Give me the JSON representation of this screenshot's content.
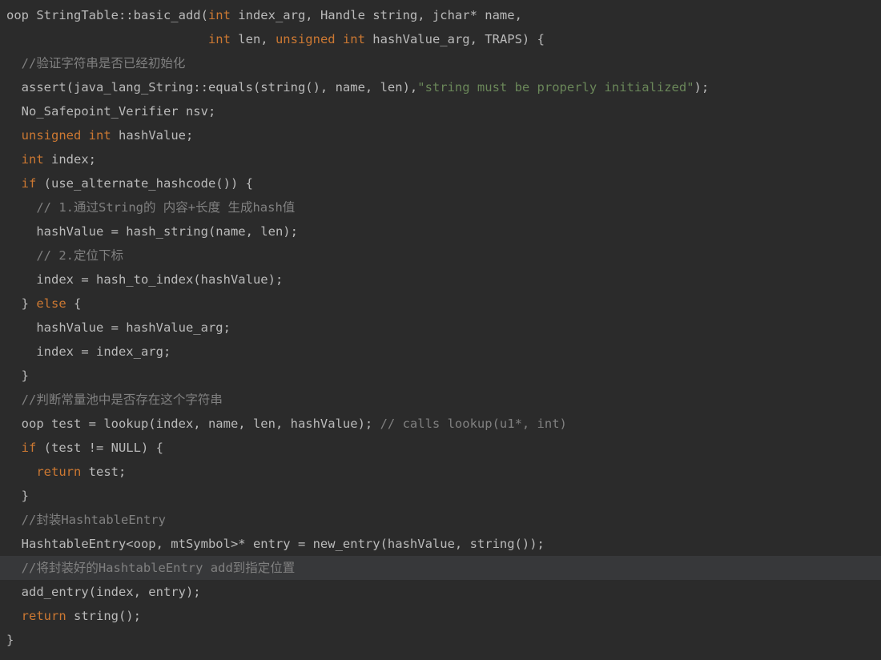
{
  "code": {
    "l01a": "oop StringTable::basic_add(",
    "l01_int1": "int",
    "l01b": " index_arg, Handle string, jchar* name,",
    "l02a": "                           ",
    "l02_int": "int",
    "l02b": " len, ",
    "l02_uns": "unsigned",
    "l02c": " ",
    "l02_int2": "int",
    "l02d": " hashValue_arg, TRAPS) {",
    "l03": "  //验证字符串是否已经初始化",
    "l04a": "  assert(java_lang_String::equals(string(), name, len),",
    "l04_str": "\"string must be properly initialized\"",
    "l04b": ");",
    "l05": "  No_Safepoint_Verifier nsv;",
    "l06_uns": "  unsigned",
    "l06_sp": " ",
    "l06_int": "int",
    "l06_rest": " hashValue;",
    "l07_int": "  int",
    "l07_rest": " index;",
    "l08_if": "  if",
    "l08_rest": " (use_alternate_hashcode()) {",
    "l09": "    // 1.通过String的 内容+长度 生成hash值",
    "l10": "    hashValue = hash_string(name, len);",
    "l11": "    // 2.定位下标",
    "l12": "    index = hash_to_index(hashValue);",
    "l13a": "  } ",
    "l13_else": "else",
    "l13b": " {",
    "l14": "    hashValue = hashValue_arg;",
    "l15": "    index = index_arg;",
    "l16": "  }",
    "l17": "  //判断常量池中是否存在这个字符串",
    "l18a": "  oop test = lookup(index, name, len, hashValue); ",
    "l18_cmt": "// calls lookup(u1*, int)",
    "l19_if": "  if",
    "l19_rest": " (test != NULL) {",
    "l20_ret": "    return",
    "l20_rest": " test;",
    "l21": "  }",
    "l22": "  //封装HashtableEntry",
    "l23": "  HashtableEntry<oop, mtSymbol>* entry = new_entry(hashValue, string());",
    "l24": "  //将封装好的HashtableEntry add到指定位置",
    "l25": "  add_entry(index, entry);",
    "l26_ret": "  return",
    "l26_rest": " string();",
    "l27": "}"
  }
}
